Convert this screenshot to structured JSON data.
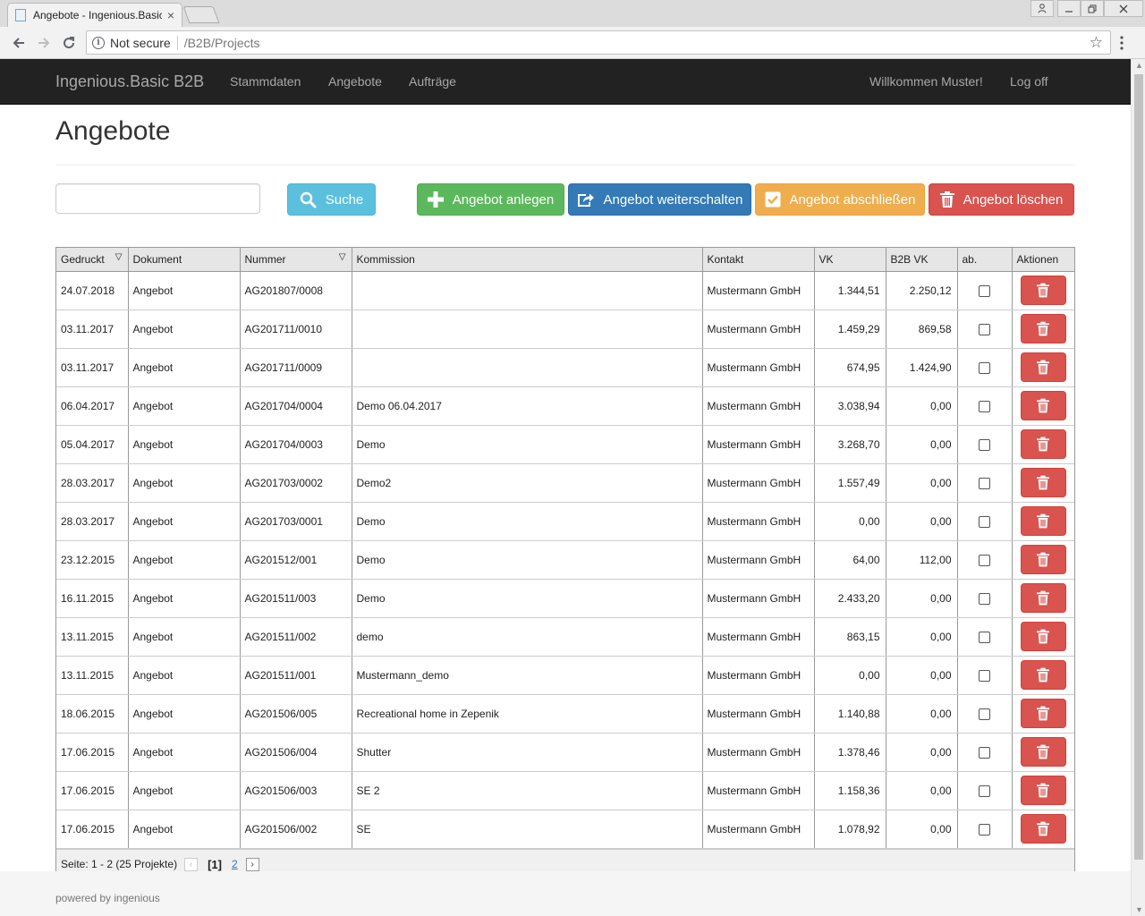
{
  "browser": {
    "tab_title": "Angebote - Ingenious.Basic B2B",
    "security_label": "Not secure",
    "url": "/B2B/Projects"
  },
  "navbar": {
    "brand": "Ingenious.Basic B2B",
    "links": [
      "Stammdaten",
      "Angebote",
      "Aufträge"
    ],
    "welcome": "Willkommen Muster!",
    "logoff": "Log off"
  },
  "page": {
    "title": "Angebote"
  },
  "search": {
    "value": "",
    "button_label": "Suche"
  },
  "actions": {
    "create": "Angebot anlegen",
    "forward": "Angebot weiterschalten",
    "complete": "Angebot abschließen",
    "delete": "Angebot löschen"
  },
  "grid": {
    "columns": [
      "Gedruckt",
      "Dokument",
      "Nummer",
      "Kommission",
      "Kontakt",
      "VK",
      "B2B VK",
      "ab.",
      "Aktionen"
    ],
    "rows": [
      {
        "gedruckt": "24.07.2018",
        "dokument": "Angebot",
        "nummer": "AG201807/0008",
        "kommission": "",
        "kontakt": "Mustermann GmbH",
        "vk": "1.344,51",
        "b2b_vk": "2.250,12"
      },
      {
        "gedruckt": "03.11.2017",
        "dokument": "Angebot",
        "nummer": "AG201711/0010",
        "kommission": "",
        "kontakt": "Mustermann GmbH",
        "vk": "1.459,29",
        "b2b_vk": "869,58"
      },
      {
        "gedruckt": "03.11.2017",
        "dokument": "Angebot",
        "nummer": "AG201711/0009",
        "kommission": "",
        "kontakt": "Mustermann GmbH",
        "vk": "674,95",
        "b2b_vk": "1.424,90"
      },
      {
        "gedruckt": "06.04.2017",
        "dokument": "Angebot",
        "nummer": "AG201704/0004",
        "kommission": "Demo 06.04.2017",
        "kontakt": "Mustermann GmbH",
        "vk": "3.038,94",
        "b2b_vk": "0,00"
      },
      {
        "gedruckt": "05.04.2017",
        "dokument": "Angebot",
        "nummer": "AG201704/0003",
        "kommission": "Demo",
        "kontakt": "Mustermann GmbH",
        "vk": "3.268,70",
        "b2b_vk": "0,00"
      },
      {
        "gedruckt": "28.03.2017",
        "dokument": "Angebot",
        "nummer": "AG201703/0002",
        "kommission": "Demo2",
        "kontakt": "Mustermann GmbH",
        "vk": "1.557,49",
        "b2b_vk": "0,00"
      },
      {
        "gedruckt": "28.03.2017",
        "dokument": "Angebot",
        "nummer": "AG201703/0001",
        "kommission": "Demo",
        "kontakt": "Mustermann GmbH",
        "vk": "0,00",
        "b2b_vk": "0,00"
      },
      {
        "gedruckt": "23.12.2015",
        "dokument": "Angebot",
        "nummer": "AG201512/001",
        "kommission": "Demo",
        "kontakt": "Mustermann GmbH",
        "vk": "64,00",
        "b2b_vk": "112,00"
      },
      {
        "gedruckt": "16.11.2015",
        "dokument": "Angebot",
        "nummer": "AG201511/003",
        "kommission": "Demo",
        "kontakt": "Mustermann GmbH",
        "vk": "2.433,20",
        "b2b_vk": "0,00"
      },
      {
        "gedruckt": "13.11.2015",
        "dokument": "Angebot",
        "nummer": "AG201511/002",
        "kommission": "demo",
        "kontakt": "Mustermann GmbH",
        "vk": "863,15",
        "b2b_vk": "0,00"
      },
      {
        "gedruckt": "13.11.2015",
        "dokument": "Angebot",
        "nummer": "AG201511/001",
        "kommission": "Mustermann_demo",
        "kontakt": "Mustermann GmbH",
        "vk": "0,00",
        "b2b_vk": "0,00"
      },
      {
        "gedruckt": "18.06.2015",
        "dokument": "Angebot",
        "nummer": "AG201506/005",
        "kommission": "Recreational home in Zepenik",
        "kontakt": "Mustermann GmbH",
        "vk": "1.140,88",
        "b2b_vk": "0,00"
      },
      {
        "gedruckt": "17.06.2015",
        "dokument": "Angebot",
        "nummer": "AG201506/004",
        "kommission": "Shutter",
        "kontakt": "Mustermann GmbH",
        "vk": "1.378,46",
        "b2b_vk": "0,00"
      },
      {
        "gedruckt": "17.06.2015",
        "dokument": "Angebot",
        "nummer": "AG201506/003",
        "kommission": "SE 2",
        "kontakt": "Mustermann GmbH",
        "vk": "1.158,36",
        "b2b_vk": "0,00"
      },
      {
        "gedruckt": "17.06.2015",
        "dokument": "Angebot",
        "nummer": "AG201506/002",
        "kommission": "SE",
        "kontakt": "Mustermann GmbH",
        "vk": "1.078,92",
        "b2b_vk": "0,00"
      }
    ]
  },
  "pager": {
    "summary": "Seite: 1 - 2 (25 Projekte)",
    "current": "[1]",
    "next_page": "2"
  },
  "footer": {
    "text": "powered by ingenious"
  },
  "colors": {
    "navbar_bg": "#222222",
    "info": "#5bc0de",
    "success": "#5cb85c",
    "primary": "#337ab7",
    "warning": "#f0ad4e",
    "danger": "#d9534f"
  },
  "icons": {
    "search_button": "search-icon",
    "create_button": "plus-icon",
    "forward_button": "share-icon",
    "complete_button": "checkbox-icon",
    "delete_button": "trash-icon"
  }
}
